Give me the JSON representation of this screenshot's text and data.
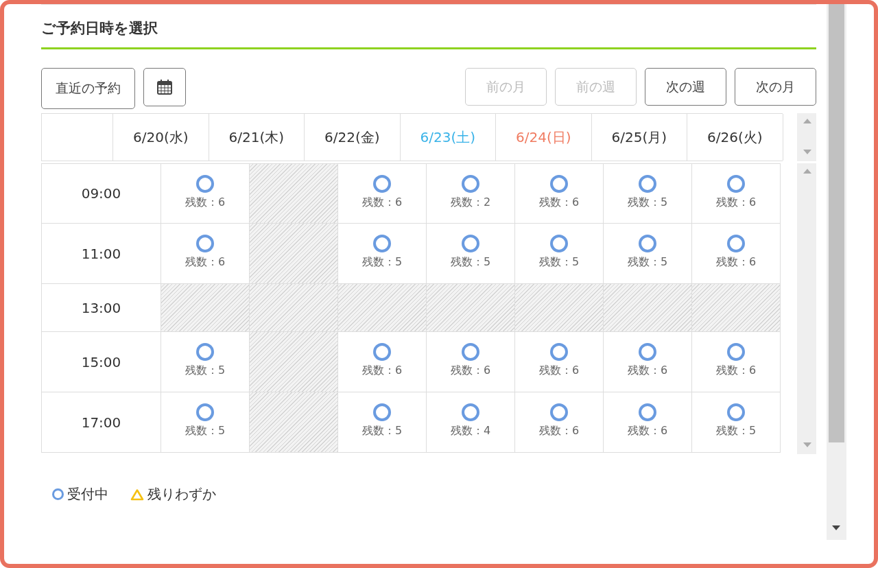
{
  "heading": "ご予約日時を選択",
  "toolbar": {
    "left": [
      {
        "kind": "text",
        "label": "直近の予約",
        "disabled": false
      },
      {
        "kind": "calendar",
        "disabled": false
      }
    ],
    "right": [
      {
        "label": "前の月",
        "disabled": true
      },
      {
        "label": "前の週",
        "disabled": true
      },
      {
        "label": "次の週",
        "disabled": false
      },
      {
        "label": "次の月",
        "disabled": false
      }
    ]
  },
  "days": [
    {
      "label": "6/20(水)",
      "kind": "weekday"
    },
    {
      "label": "6/21(木)",
      "kind": "weekday"
    },
    {
      "label": "6/22(金)",
      "kind": "weekday"
    },
    {
      "label": "6/23(土)",
      "kind": "saturday"
    },
    {
      "label": "6/24(日)",
      "kind": "sunday"
    },
    {
      "label": "6/25(月)",
      "kind": "weekday"
    },
    {
      "label": "6/26(火)",
      "kind": "weekday"
    }
  ],
  "rows": [
    {
      "time": "09:00",
      "cells": [
        {
          "kind": "open",
          "count": "残数：6"
        },
        {
          "kind": "closed"
        },
        {
          "kind": "open",
          "count": "残数：6"
        },
        {
          "kind": "open",
          "count": "残数：2"
        },
        {
          "kind": "open",
          "count": "残数：6"
        },
        {
          "kind": "open",
          "count": "残数：5"
        },
        {
          "kind": "open",
          "count": "残数：6"
        }
      ]
    },
    {
      "time": "11:00",
      "cells": [
        {
          "kind": "open",
          "count": "残数：6"
        },
        {
          "kind": "closed"
        },
        {
          "kind": "open",
          "count": "残数：5"
        },
        {
          "kind": "open",
          "count": "残数：5"
        },
        {
          "kind": "open",
          "count": "残数：5"
        },
        {
          "kind": "open",
          "count": "残数：5"
        },
        {
          "kind": "open",
          "count": "残数：6"
        }
      ]
    },
    {
      "time": "13:00",
      "cells": [
        {
          "kind": "closed"
        },
        {
          "kind": "closed"
        },
        {
          "kind": "closed"
        },
        {
          "kind": "closed"
        },
        {
          "kind": "closed"
        },
        {
          "kind": "closed"
        },
        {
          "kind": "closed"
        }
      ]
    },
    {
      "time": "15:00",
      "cells": [
        {
          "kind": "open",
          "count": "残数：5"
        },
        {
          "kind": "closed"
        },
        {
          "kind": "open",
          "count": "残数：6"
        },
        {
          "kind": "open",
          "count": "残数：6"
        },
        {
          "kind": "open",
          "count": "残数：6"
        },
        {
          "kind": "open",
          "count": "残数：6"
        },
        {
          "kind": "open",
          "count": "残数：6"
        }
      ]
    },
    {
      "time": "17:00",
      "cells": [
        {
          "kind": "open",
          "count": "残数：5"
        },
        {
          "kind": "closed"
        },
        {
          "kind": "open",
          "count": "残数：5"
        },
        {
          "kind": "open",
          "count": "残数：4"
        },
        {
          "kind": "open",
          "count": "残数：6"
        },
        {
          "kind": "open",
          "count": "残数：6"
        },
        {
          "kind": "open",
          "count": "残数：5"
        }
      ]
    }
  ],
  "legend": [
    {
      "kind": "circle",
      "label": "受付中"
    },
    {
      "kind": "triangle",
      "label": "残りわずか"
    }
  ]
}
